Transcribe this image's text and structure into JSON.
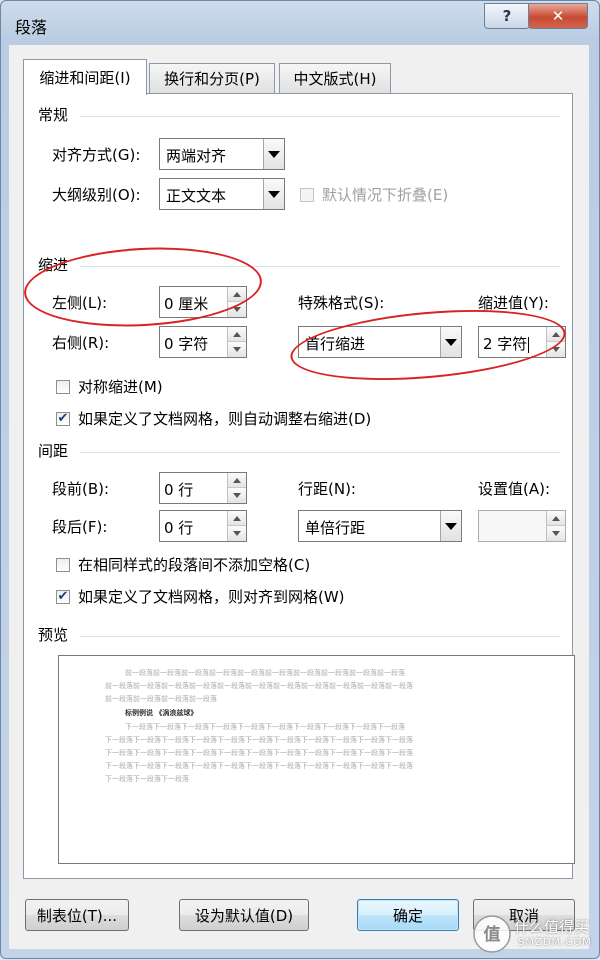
{
  "window": {
    "title": "段落",
    "help": "?",
    "close": "✕"
  },
  "tabs": [
    {
      "label": "缩进和间距(I)",
      "active": true
    },
    {
      "label": "换行和分页(P)"
    },
    {
      "label": "中文版式(H)"
    }
  ],
  "general": {
    "heading": "常规",
    "alignment_label": "对齐方式(G):",
    "alignment_value": "两端对齐",
    "outline_label": "大纲级别(O):",
    "outline_value": "正文文本",
    "collapse_label": "默认情况下折叠(E)"
  },
  "indent": {
    "heading": "缩进",
    "left_label": "左侧(L):",
    "left_value": "0 厘米",
    "right_label": "右侧(R):",
    "right_value": "0 字符",
    "special_label": "特殊格式(S):",
    "special_value": "首行缩进",
    "by_label": "缩进值(Y):",
    "by_value": "2 字符",
    "mirror_label": "对称缩进(M)",
    "auto_adjust_label": "如果定义了文档网格，则自动调整右缩进(D)"
  },
  "spacing": {
    "heading": "间距",
    "before_label": "段前(B):",
    "before_value": "0 行",
    "after_label": "段后(F):",
    "after_value": "0 行",
    "line_label": "行距(N):",
    "line_value": "单倍行距",
    "at_label": "设置值(A):",
    "at_value": "",
    "no_space_label": "在相同样式的段落间不添加空格(C)",
    "snap_grid_label": "如果定义了文档网格，则对齐到网格(W)"
  },
  "preview": {
    "heading": "预览",
    "prev_lines": [
      "前一段落前一段落前一段落前一段落前一段落前一段落前一段落前一段落前一段落前一段落",
      "前一段落前一段落前一段落前一段落前一段落前一段落前一段落前一段落前一段落前一段落前一段落",
      "前一段落前一段落前一段落前一段落"
    ],
    "current_line": "标例例说 《涡浪兹球》",
    "next_lines": [
      "下一段落下一段落下一段落下一段落下一段落下一段落下一段落下一段落下一段落下一段落",
      "下一段落下一段落下一段落下一段落下一段落下一段落下一段落下一段落下一段落下一段落下一段落",
      "下一段落下一段落下一段落下一段落下一段落下一段落下一段落下一段落下一段落下一段落下一段落",
      "下一段落下一段落下一段落下一段落下一段落下一段落下一段落下一段落下一段落下一段落下一段落",
      "下一段落下一段落下一段落"
    ]
  },
  "buttons": {
    "tabs": "制表位(T)...",
    "set_default": "设为默认值(D)",
    "ok": "确定",
    "cancel": "取消"
  },
  "watermark": {
    "text1": "什么值得买",
    "text2": "SMZDM.COM"
  },
  "colors": {
    "annotation": "#d92222",
    "accent": "#3c7fb1"
  }
}
